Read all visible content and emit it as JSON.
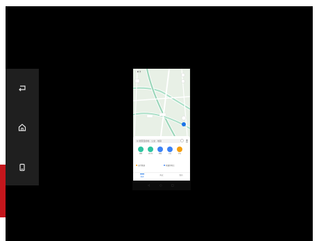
{
  "colors": {
    "screen": "#000000",
    "side_rail": "#1f1f1f",
    "accent_red": "#c4161c",
    "map_green": "#8fd3b3",
    "brand_blue": "#1a73e8"
  },
  "side_rail": {
    "buttons": [
      {
        "icon": "back-icon"
      },
      {
        "icon": "home-icon"
      },
      {
        "icon": "recent-apps-icon"
      }
    ]
  },
  "phone": {
    "search_placeholder": "Q 搜索目的地 · 公交 · 地铁",
    "quick_actions": [
      {
        "icon": "home-circle-icon",
        "label": "回家",
        "color": "#2ec4a0"
      },
      {
        "icon": "company-circle-icon",
        "label": "去公司",
        "color": "#2ec4a0"
      },
      {
        "icon": "subway-circle-icon",
        "label": "地铁",
        "color": "#3b82f6"
      },
      {
        "icon": "bus-circle-icon",
        "label": "公交",
        "color": "#3b82f6"
      },
      {
        "icon": "taxi-circle-icon",
        "label": "打车",
        "color": "#f59e0b"
      }
    ],
    "shortcuts": [
      {
        "label": "出行路线",
        "color": "#f59e0b"
      },
      {
        "label": "收藏的地点",
        "color": "#3b82f6"
      }
    ],
    "tabs": [
      "首页",
      "附近",
      "我的"
    ],
    "nav_keys": [
      "◁",
      "○",
      "□"
    ]
  }
}
